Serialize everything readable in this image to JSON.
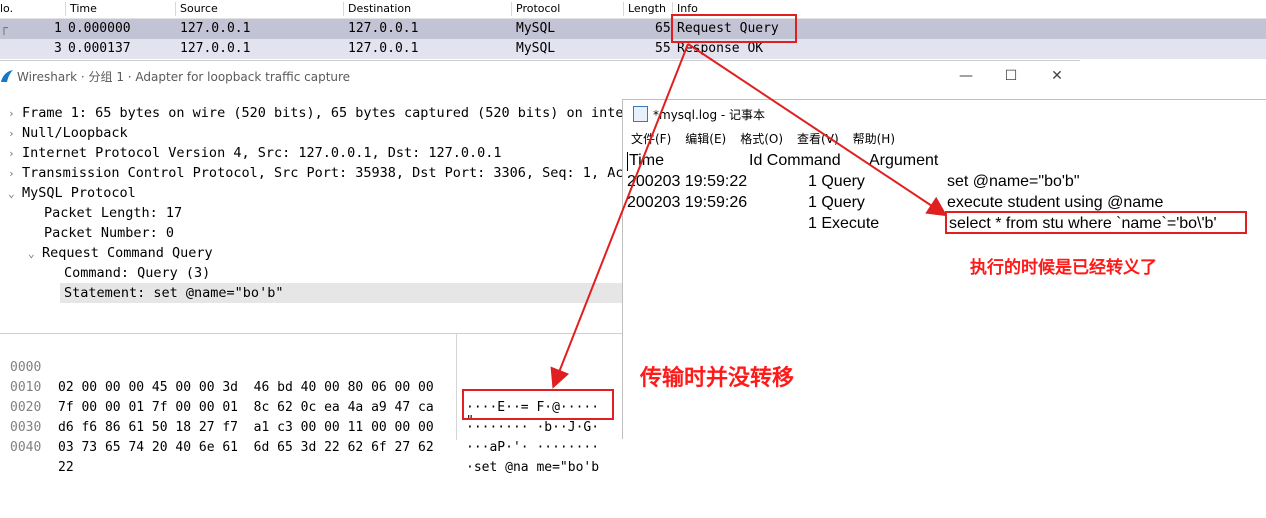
{
  "packet_list": {
    "columns": [
      "lo.",
      "Time",
      "Source",
      "Destination",
      "Protocol",
      "Length",
      "Info"
    ],
    "rows": [
      {
        "no": "1",
        "time": "0.000000",
        "source": "127.0.0.1",
        "destination": "127.0.0.1",
        "protocol": "MySQL",
        "length": "65",
        "info": "Request Query"
      },
      {
        "no": "3",
        "time": "0.000137",
        "source": "127.0.0.1",
        "destination": "127.0.0.1",
        "protocol": "MySQL",
        "length": "55",
        "info": "Response OK"
      }
    ]
  },
  "wireshark_window": {
    "title": "Wireshark · 分组 1 · Adapter for loopback traffic capture",
    "tree": [
      {
        "text": "Frame 1: 65 bytes on wire (520 bits), 65 bytes captured (520 bits) on inter",
        "expander": "›"
      },
      {
        "text": "Null/Loopback",
        "expander": "›"
      },
      {
        "text": "Internet Protocol Version 4, Src: 127.0.0.1, Dst: 127.0.0.1",
        "expander": "›"
      },
      {
        "text": "Transmission Control Protocol, Src Port: 35938, Dst Port: 3306, Seq: 1, Ack",
        "expander": "›"
      },
      {
        "text": "MySQL Protocol",
        "expander": "⌄"
      },
      {
        "text": "Packet Length: 17",
        "expander": ""
      },
      {
        "text": "Packet Number: 0",
        "expander": ""
      },
      {
        "text": "Request Command Query",
        "expander": "⌄"
      },
      {
        "text": "Command: Query (3)",
        "expander": ""
      },
      {
        "text": "Statement: set @name=\"bo'b\"",
        "expander": ""
      }
    ],
    "hex": [
      {
        "offset": "0000",
        "bytes": "02 00 00 00 45 00 00 3d  46 bd 40 00 80 06 00 00",
        "ascii": "····E··= F·@·····"
      },
      {
        "offset": "0010",
        "bytes": "7f 00 00 01 7f 00 00 01  8c 62 0c ea 4a a9 47 ca",
        "ascii": "········ ·b··J·G·"
      },
      {
        "offset": "0020",
        "bytes": "d6 f6 86 61 50 18 27 f7  a1 c3 00 00 11 00 00 00",
        "ascii": "···aP·'· ········"
      },
      {
        "offset": "0030",
        "bytes": "03 73 65 74 20 40 6e 61  6d 65 3d 22 62 6f 27 62",
        "ascii": "·set @na me=\"bo'b"
      },
      {
        "offset": "0040",
        "bytes": "22",
        "ascii": "\""
      }
    ]
  },
  "notepad": {
    "title": "*mysql.log - 记事本",
    "menu": [
      "文件(F)",
      "编辑(E)",
      "格式(O)",
      "查看(V)",
      "帮助(H)"
    ],
    "header": {
      "time": "Time",
      "id_command": "Id Command",
      "argument": "Argument"
    },
    "rows": [
      {
        "time": "200203 19:59:22",
        "id_cmd": "1 Query",
        "arg": "set @name=\"bo'b\""
      },
      {
        "time": "200203 19:59:26",
        "id_cmd": "1 Query",
        "arg": "execute student using @name"
      },
      {
        "time": "",
        "id_cmd": "1 Execute",
        "arg": "select * from stu where `name`='bo\\'b'"
      }
    ]
  },
  "annotations": {
    "executed_note": "执行的时候是已经转义了",
    "transfer_note": "传输时并没转移"
  },
  "colors": {
    "selected_row": "#c3c3d6",
    "second_row": "#e3e3f0",
    "annotation_red": "#e02020"
  }
}
